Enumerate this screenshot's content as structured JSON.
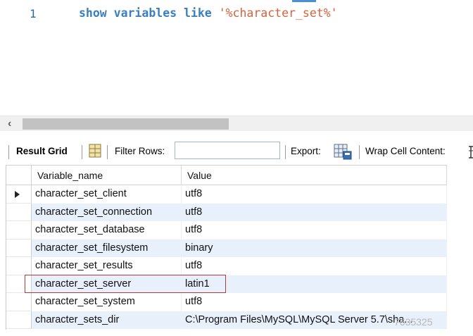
{
  "editor": {
    "line_number": "1",
    "code_keyword": "show variables like",
    "code_string": "'%character_set%'"
  },
  "toolbar": {
    "result_grid_label": "Result Grid",
    "filter_rows_label": "Filter Rows:",
    "filter_value": "",
    "export_label": "Export:",
    "wrap_label": "Wrap Cell Content:"
  },
  "grid": {
    "columns": [
      "Variable_name",
      "Value"
    ],
    "rows": [
      {
        "name": "character_set_client",
        "value": "utf8"
      },
      {
        "name": "character_set_connection",
        "value": "utf8"
      },
      {
        "name": "character_set_database",
        "value": "utf8"
      },
      {
        "name": "character_set_filesystem",
        "value": "binary"
      },
      {
        "name": "character_set_results",
        "value": "utf8"
      },
      {
        "name": "character_set_server",
        "value": "latin1"
      },
      {
        "name": "character_set_system",
        "value": "utf8"
      },
      {
        "name": "character_sets_dir",
        "value": "C:\\Program Files\\MySQL\\MySQL Server 5.7\\sha..."
      }
    ]
  },
  "icons": {
    "grid_icon": "grid-layout-icon",
    "export_icon": "export-icon",
    "wrap_icon": "wrap-cell-icon",
    "row_pointer": "row-pointer-icon"
  },
  "colors": {
    "keyword": "#3a7fc0",
    "string": "#d4623a",
    "row_alt": "#e8f0fb",
    "highlight": "#b23a3a"
  },
  "watermark": "7635325"
}
